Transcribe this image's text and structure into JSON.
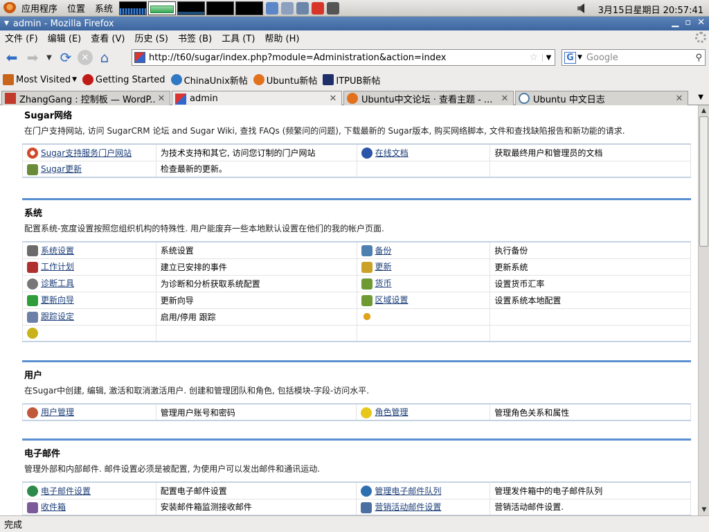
{
  "panel": {
    "menus": [
      "应用程序",
      "位置",
      "系统"
    ],
    "clock": "3月15日星期日 20:57:41"
  },
  "window": {
    "title": "admin - Mozilla Firefox"
  },
  "menubar": [
    "文件 (F)",
    "编辑 (E)",
    "查看 (V)",
    "历史 (S)",
    "书签 (B)",
    "工具 (T)",
    "帮助 (H)"
  ],
  "navbar": {
    "url": "http://t60/sugar/index.php?module=Administration&action=index",
    "search_engine": "G",
    "search_placeholder": "Google"
  },
  "bookmarks": [
    {
      "label": "Most Visited",
      "icon": "bookmarks-folder-icon",
      "color": "#c8651b"
    },
    {
      "label": "Getting Started",
      "icon": "firefox-red-icon",
      "color": "#c11b17"
    },
    {
      "label": "ChinaUnix新帖",
      "icon": "chinaunix-icon",
      "color": "#2f78c4"
    },
    {
      "label": "Ubuntu新帖",
      "icon": "ubuntu-icon",
      "color": "#e2711d"
    },
    {
      "label": "ITPUB新帖",
      "icon": "itpub-icon",
      "color": "#1f2f6a"
    }
  ],
  "tabs": [
    {
      "label": "ZhangGang : 控制板 — WordP...",
      "icon": "wordpress-icon",
      "active": false
    },
    {
      "label": "admin",
      "icon": "sugarcrm-icon",
      "active": true
    },
    {
      "label": "Ubuntu中文论坛 · 查看主题 - ...",
      "icon": "ubuntu-icon",
      "active": false
    },
    {
      "label": "Ubuntu 中文日志",
      "icon": "blog-icon",
      "active": false
    }
  ],
  "sections": [
    {
      "title": "Sugar网络",
      "desc": "在门户支持网站, 访问 SugarCRM 论坛 and Sugar Wiki, 查找 FAQs (频繁问的问题), 下载最新的 Sugar版本, 购买网络脚本, 文件和查找缺陷报告和新功能的请求.",
      "rows": [
        [
          {
            "icon": "lifebuoy-icon",
            "color": "#d04a2a",
            "link": "Sugar支持服务门户网站",
            "desc": "为技术支持和其它, 访问您订制的门户网站"
          },
          {
            "icon": "book-icon",
            "color": "#2b55a8",
            "link": "在线文档",
            "desc": "获取最终用户和管理员的文档"
          }
        ],
        [
          {
            "icon": "antenna-icon",
            "color": "#6a8b3a",
            "link": "Sugar更新",
            "desc": "检查最新的更新。"
          },
          {
            "icon": "",
            "color": "",
            "link": "",
            "desc": ""
          }
        ]
      ]
    },
    {
      "title": "系统",
      "desc": "配置系统-宽度设置按照您组织机构的特殊性. 用户能废弃一些本地默认设置在他们的我的帐户页面.",
      "rows": [
        [
          {
            "icon": "wrench-icon",
            "color": "#6b6b6b",
            "link": "系统设置",
            "desc": "系统设置"
          },
          {
            "icon": "backup-icon",
            "color": "#4d7fb0",
            "link": "备份",
            "desc": "执行备份"
          }
        ],
        [
          {
            "icon": "scheduler-icon",
            "color": "#b03030",
            "link": "工作计划",
            "desc": "建立已安排的事件"
          },
          {
            "icon": "upgrade-icon",
            "color": "#c9a227",
            "link": "更新",
            "desc": "更新系统"
          }
        ],
        [
          {
            "icon": "stethoscope-icon",
            "color": "#777777",
            "link": "诊断工具",
            "desc": "为诊断和分析获取系统配置"
          },
          {
            "icon": "currency-icon",
            "color": "#6f9a33",
            "link": "货币",
            "desc": "设置货币汇率"
          }
        ],
        [
          {
            "icon": "arrow-up-icon",
            "color": "#2f9e3a",
            "link": "更新向导",
            "desc": "更新向导"
          },
          {
            "icon": "locale-icon",
            "color": "#6f9a33",
            "link": "区域设置",
            "desc": "设置系统本地配置"
          }
        ],
        [
          {
            "icon": "tracker-icon",
            "color": "#6b7fa8",
            "link": "跟踪设定",
            "desc": "启用/停用 跟踪"
          },
          {
            "icon": "sun-icon",
            "color": "#e0a41b",
            "link": "",
            "desc": ""
          }
        ],
        [
          {
            "icon": "database-icon",
            "color": "#c9b21b",
            "link": "",
            "desc": ""
          },
          {
            "icon": "",
            "color": "",
            "link": "",
            "desc": ""
          }
        ]
      ]
    },
    {
      "title": "用户",
      "desc": "在Sugar中创建, 编辑, 激活和取消激活用户. 创建和管理团队和角色, 包括模块-字段-访问水平.",
      "rows": [
        [
          {
            "icon": "users-icon",
            "color": "#c0583a",
            "link": "用户管理",
            "desc": "管理用户账号和密码"
          },
          {
            "icon": "roles-icon",
            "color": "#e8c71b",
            "link": "角色管理",
            "desc": "管理角色关系和属性"
          }
        ]
      ]
    },
    {
      "title": "电子邮件",
      "desc": "管理外部和内部邮件. 邮件设置必须是被配置, 为使用户可以发出邮件和通讯运动.",
      "rows": [
        [
          {
            "icon": "email-settings-icon",
            "color": "#2e8a4a",
            "link": "电子邮件设置",
            "desc": "配置电子邮件设置"
          },
          {
            "icon": "email-queue-icon",
            "color": "#2e6fb0",
            "link": "管理电子邮件队列",
            "desc": "管理发件箱中的电子邮件队列"
          }
        ],
        [
          {
            "icon": "inbox-icon",
            "color": "#7b5a9a",
            "link": "收件箱",
            "desc": "安装邮件箱监测接收邮件"
          },
          {
            "icon": "campaign-email-icon",
            "color": "#4a6fa0",
            "link": "营销活动邮件设置",
            "desc": "营销活动邮件设置."
          }
        ]
      ]
    }
  ],
  "status": "完成"
}
